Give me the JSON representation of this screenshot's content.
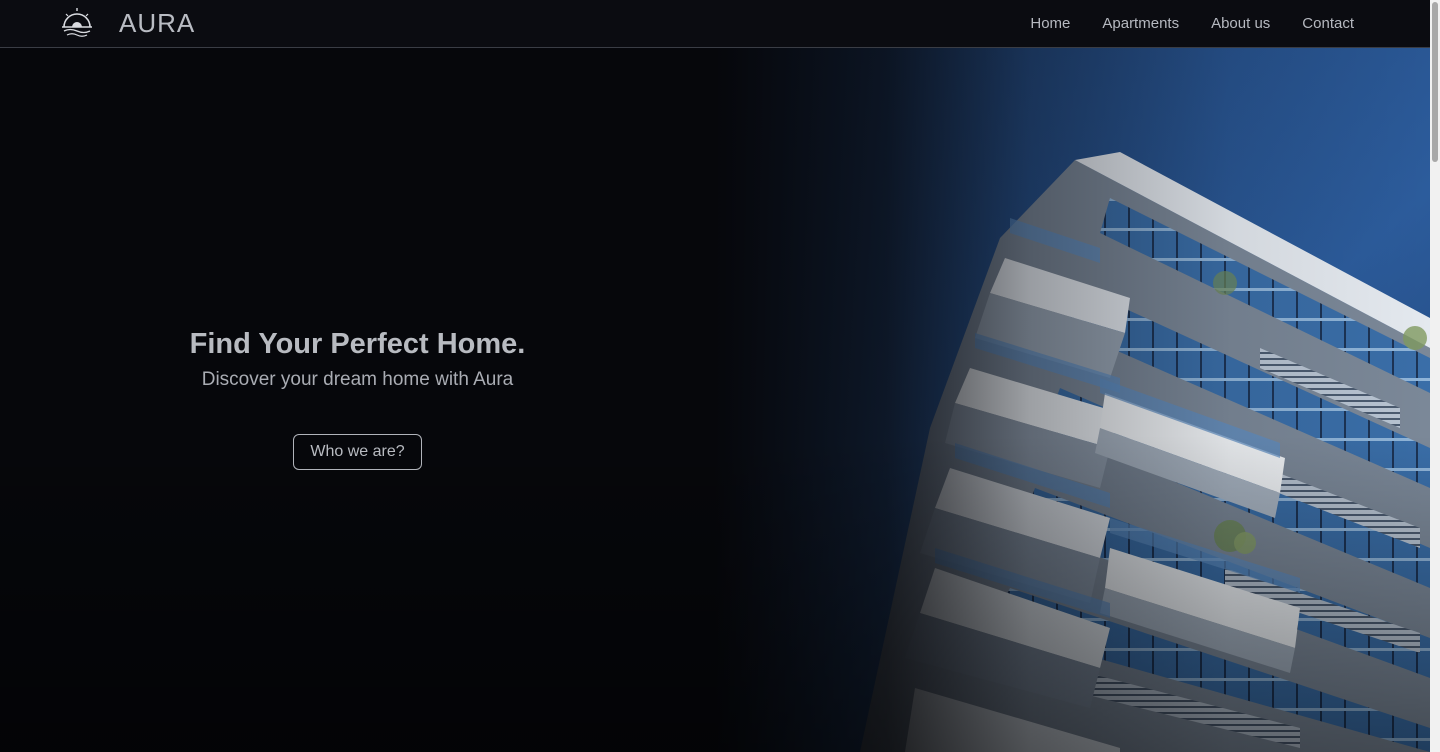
{
  "nav": {
    "brand": "AURA",
    "links": [
      "Home",
      "Apartments",
      "About us",
      "Contact"
    ]
  },
  "hero": {
    "title": "Find Your Perfect Home.",
    "subtitle": "Discover your dream home with Aura",
    "button_label": "Who we are?"
  },
  "colors": {
    "background": "#06070b",
    "navbar": "#0b0c11",
    "sky": "#2a5a9a",
    "text": "#b8bbc1"
  },
  "icons": {
    "logo": "sunset-over-water-logo"
  }
}
